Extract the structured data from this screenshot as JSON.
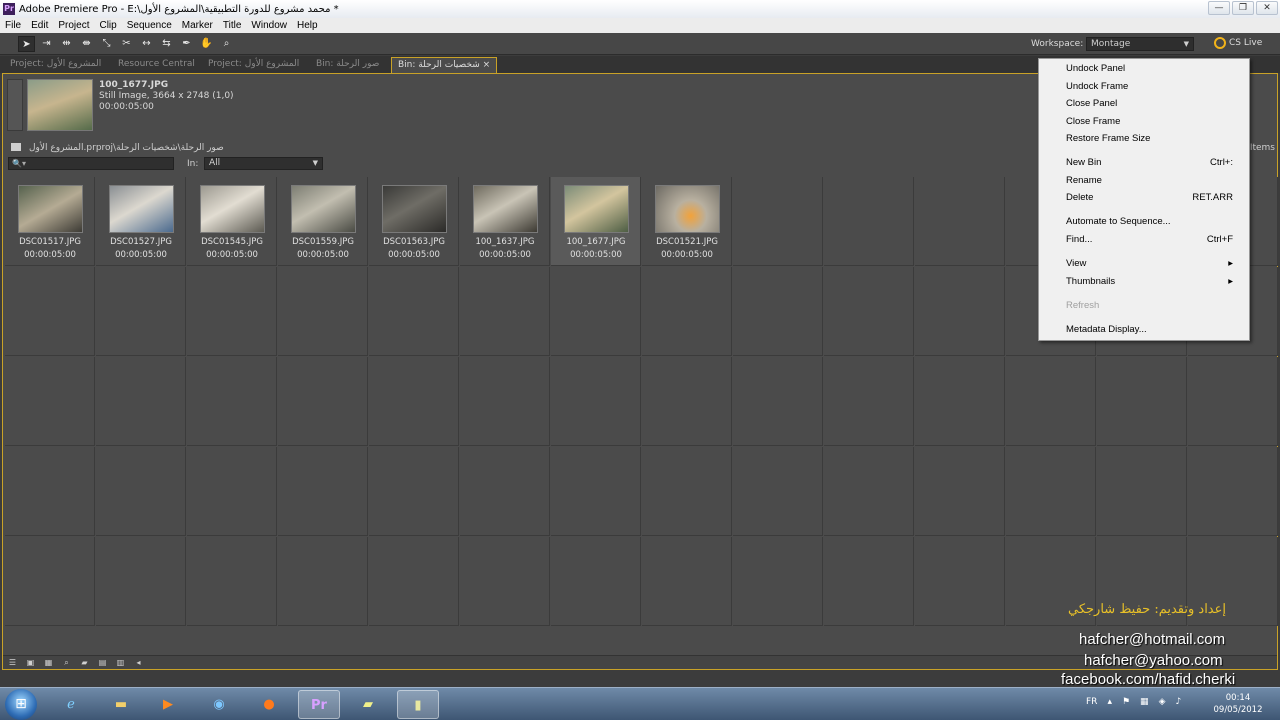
{
  "window": {
    "title": "Adobe Premiere Pro - E:\\محمد مشروع للدورة التطبيقية\\المشروع الأول *",
    "controls": [
      "—",
      "❐",
      "✕"
    ]
  },
  "menu": [
    "File",
    "Edit",
    "Project",
    "Clip",
    "Sequence",
    "Marker",
    "Title",
    "Window",
    "Help"
  ],
  "toolbar": {
    "tools": [
      "selection-tool-icon",
      "track-select-icon",
      "ripple-edit-icon",
      "rolling-edit-icon",
      "rate-stretch-icon",
      "razor-icon",
      "slip-icon",
      "slide-icon",
      "pen-icon",
      "hand-icon",
      "zoom-icon"
    ],
    "workspace_label": "Workspace:",
    "workspace_value": "Montage",
    "cslive_label": "CS Live"
  },
  "tabs": [
    {
      "label": "Project: المشروع الأول",
      "active": false
    },
    {
      "label": "Resource Central",
      "active": false
    },
    {
      "label": "Project: المشروع الأول",
      "active": false
    },
    {
      "label": "Bin: صور الرحلة",
      "active": false
    },
    {
      "label": "Bin: شخصيات الرحلة ×",
      "active": true
    }
  ],
  "preview": {
    "name": "100_1677.JPG",
    "type": "Still Image, 3664 x 2748 (1,0)",
    "duration": "00:00:05:00"
  },
  "bin": {
    "path": "المشروع الأول.prproj\\صور الرحلة\\شخصيات الرحلة",
    "search_placeholder": "🔍▾",
    "in_label": "In:",
    "in_value": "All",
    "items_label": "Items"
  },
  "clips": [
    {
      "name": "DSC01517.JPG",
      "duration": "00:00:05:00",
      "selected": false
    },
    {
      "name": "DSC01527.JPG",
      "duration": "00:00:05:00",
      "selected": false
    },
    {
      "name": "DSC01545.JPG",
      "duration": "00:00:05:00",
      "selected": false
    },
    {
      "name": "DSC01559.JPG",
      "duration": "00:00:05:00",
      "selected": false
    },
    {
      "name": "DSC01563.JPG",
      "duration": "00:00:05:00",
      "selected": false
    },
    {
      "name": "100_1637.JPG",
      "duration": "00:00:05:00",
      "selected": false
    },
    {
      "name": "100_1677.JPG",
      "duration": "00:00:05:00",
      "selected": true
    },
    {
      "name": "DSC01521.JPG",
      "duration": "00:00:05:00",
      "selected": false
    }
  ],
  "context_menu": [
    {
      "label": "Undock Panel",
      "shortcut": "",
      "enabled": true
    },
    {
      "label": "Undock Frame",
      "shortcut": "",
      "enabled": true
    },
    {
      "label": "Close Panel",
      "shortcut": "",
      "enabled": true
    },
    {
      "label": "Close Frame",
      "shortcut": "",
      "enabled": true
    },
    {
      "label": "Restore Frame Size",
      "shortcut": "",
      "enabled": true
    },
    {
      "label": "New Bin",
      "shortcut": "Ctrl+:",
      "enabled": true
    },
    {
      "label": "Rename",
      "shortcut": "",
      "enabled": true
    },
    {
      "label": "Delete",
      "shortcut": "RET.ARR",
      "enabled": true
    },
    {
      "label": "Automate to Sequence...",
      "shortcut": "",
      "enabled": true
    },
    {
      "label": "Find...",
      "shortcut": "Ctrl+F",
      "enabled": true
    },
    {
      "label": "View",
      "shortcut": "▸",
      "enabled": true
    },
    {
      "label": "Thumbnails",
      "shortcut": "▸",
      "enabled": true
    },
    {
      "label": "Refresh",
      "shortcut": "",
      "enabled": false
    },
    {
      "label": "Metadata Display...",
      "shortcut": "",
      "enabled": true
    }
  ],
  "watermark": {
    "arabic": "إعداد وتقديم: حفيظ شارجكي",
    "email1": "hafcher@hotmail.com",
    "email2": "hafcher@yahoo.com",
    "facebook": "facebook.com/hafid.cherki"
  },
  "taskbar": {
    "language": "FR",
    "time": "00:14",
    "date": "09/05/2012"
  },
  "colors": {
    "panel_bg": "#4b4b4b",
    "active_border": "#c9a227",
    "menu_bg": "#f0f0f0",
    "watermark_gold": "#e8c028"
  }
}
